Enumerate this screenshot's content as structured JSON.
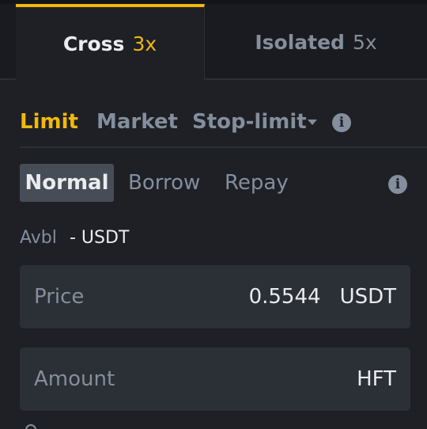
{
  "margin_modes": {
    "cross": {
      "label": "Cross",
      "leverage": "3x"
    },
    "isolated": {
      "label": "Isolated",
      "leverage": "5x"
    }
  },
  "order_types": {
    "limit": "Limit",
    "market": "Market",
    "stop_limit": "Stop-limit"
  },
  "sub_tabs": {
    "normal": "Normal",
    "borrow": "Borrow",
    "repay": "Repay"
  },
  "available": {
    "label": "Avbl",
    "value": "- USDT"
  },
  "price_field": {
    "label": "Price",
    "value": "0.5544",
    "unit": "USDT"
  },
  "amount_field": {
    "label": "Amount",
    "value": "",
    "unit": "HFT"
  },
  "icons": {
    "info": "i"
  },
  "colors": {
    "accent": "#f0b90b",
    "background": "#1e2026",
    "muted": "#848e9c",
    "text": "#eaecef"
  }
}
